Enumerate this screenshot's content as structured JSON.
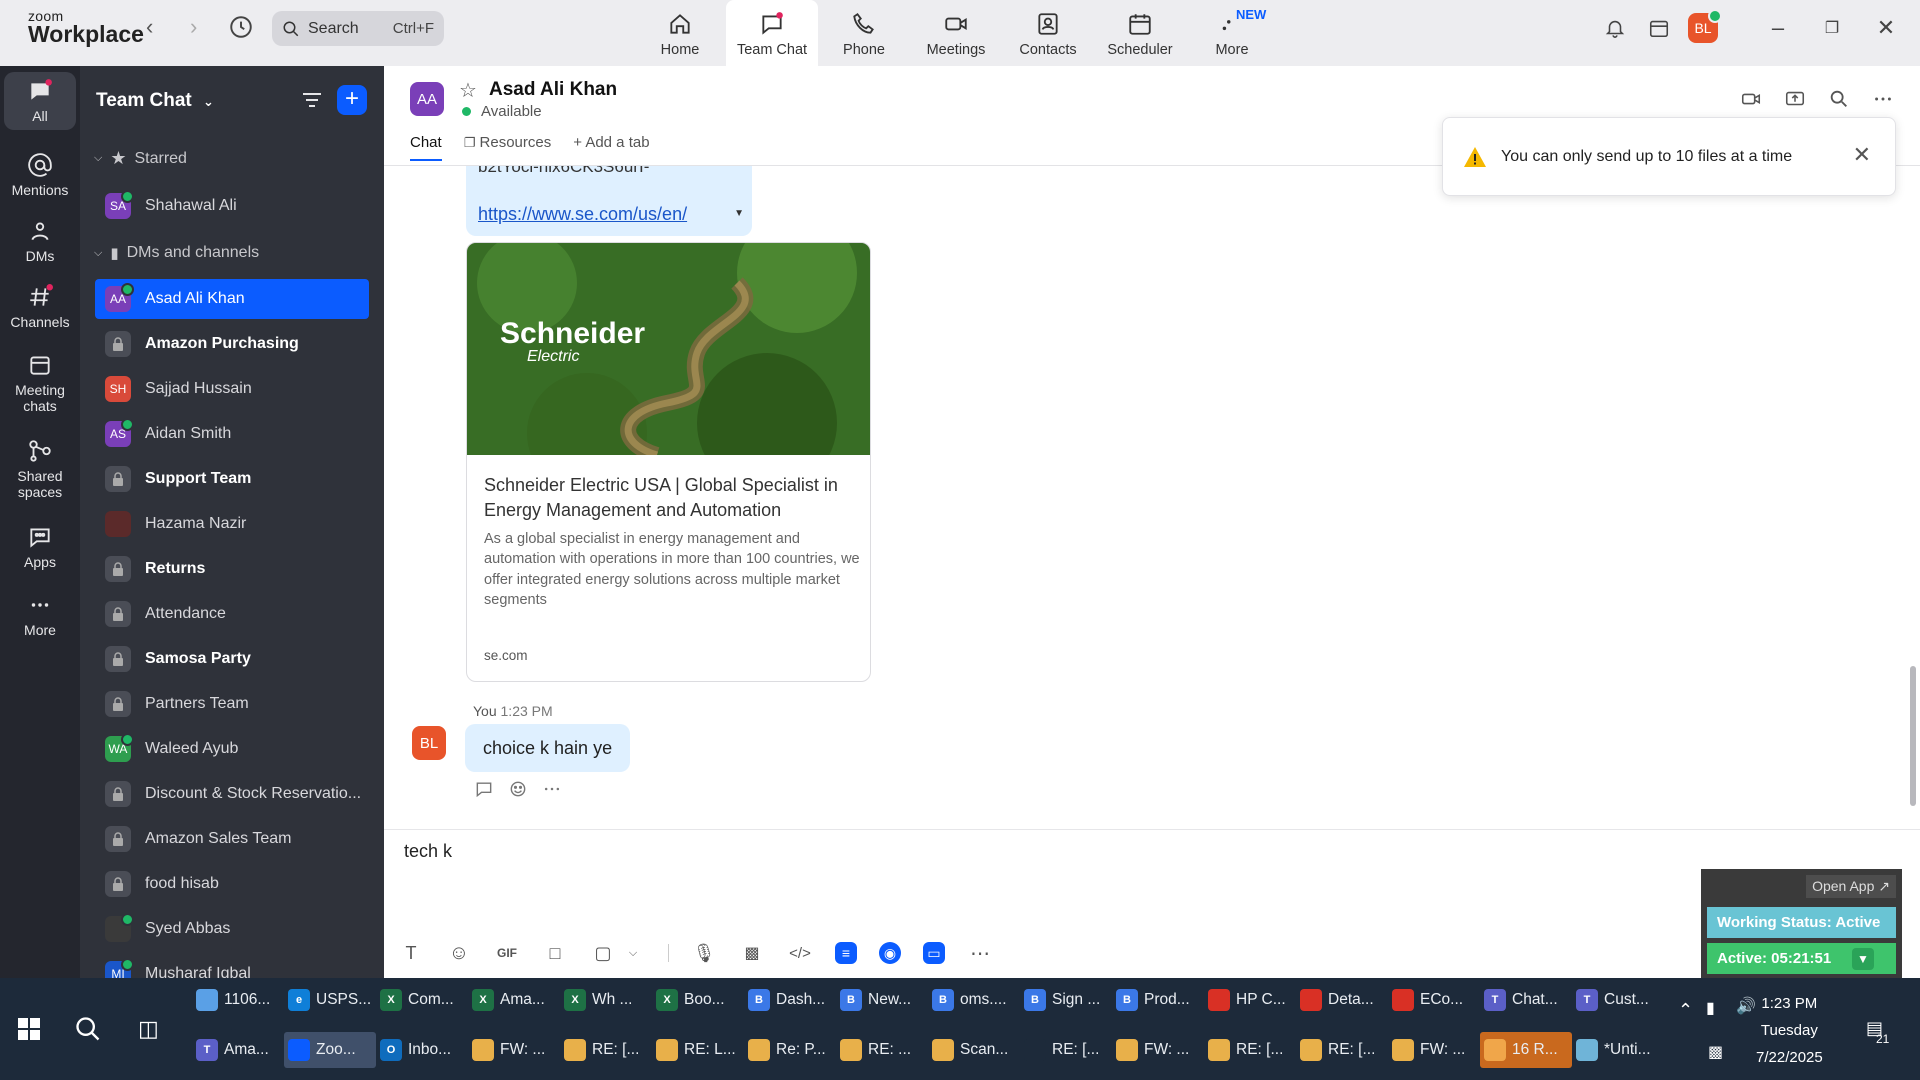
{
  "app": {
    "brand_small": "zoom",
    "brand_big": "Workplace"
  },
  "search": {
    "label": "Search",
    "shortcut": "Ctrl+F"
  },
  "top_tabs": [
    {
      "label": "Home"
    },
    {
      "label": "Team Chat"
    },
    {
      "label": "Phone"
    },
    {
      "label": "Meetings"
    },
    {
      "label": "Contacts"
    },
    {
      "label": "Scheduler"
    },
    {
      "label": "More",
      "badge": "NEW"
    }
  ],
  "user_initials": "BL",
  "rail": [
    {
      "label": "All"
    },
    {
      "label": "Mentions"
    },
    {
      "label": "DMs"
    },
    {
      "label": "Channels"
    },
    {
      "label": "Meeting chats"
    },
    {
      "label": "Shared spaces"
    },
    {
      "label": "Apps"
    },
    {
      "label": "More"
    }
  ],
  "sidebar": {
    "title": "Team Chat",
    "starred_label": "Starred",
    "dms_label": "DMs and channels",
    "starred": [
      {
        "initials": "SA",
        "name": "Shahawal Ali",
        "color": "#7a3fb8"
      }
    ],
    "items": [
      {
        "initials": "AA",
        "name": "Asad Ali Khan",
        "color": "#7a3fb8"
      },
      {
        "name": "Amazon Purchasing"
      },
      {
        "initials": "SH",
        "name": "Sajjad Hussain",
        "color": "#d94a3a"
      },
      {
        "initials": "AS",
        "name": "Aidan Smith",
        "color": "#7a3fb8"
      },
      {
        "name": "Support Team"
      },
      {
        "initials": "",
        "name": "Hazama Nazir",
        "color": "#5b2a2a"
      },
      {
        "name": "Returns"
      },
      {
        "name": "Attendance"
      },
      {
        "name": "Samosa Party"
      },
      {
        "name": "Partners Team"
      },
      {
        "initials": "WA",
        "name": "Waleed Ayub",
        "color": "#2e9e4f"
      },
      {
        "name": "Discount & Stock Reservatio..."
      },
      {
        "name": "Amazon Sales Team"
      },
      {
        "name": "food hisab"
      },
      {
        "initials": "",
        "name": "Syed Abbas",
        "color": "#3a3a3a"
      },
      {
        "initials": "MI",
        "name": "Musharaf Iqbal",
        "color": "#1a56c9"
      }
    ]
  },
  "chat": {
    "contact_initials": "AA",
    "contact_name": "Asad Ali Khan",
    "status": "Available",
    "tabs": {
      "chat": "Chat",
      "resources": "Resources",
      "add": "Add a tab"
    },
    "link_fragment": "b2tYoci-nix6CK3S6urI-",
    "link_url": "https://www.se.com/us/en/",
    "card": {
      "logo_main": "Schneider",
      "logo_sub": "Electric",
      "title": "Schneider Electric USA | Global Specialist in Energy Management and Automation",
      "description": "As a global specialist in energy management  and automation with operations in more than 100 countries, we offer integrated energy solutions across multiple market segments",
      "domain": "se.com"
    },
    "message": {
      "sender": "You",
      "time": "1:23 PM",
      "initials": "BL",
      "text": "choice k hain ye"
    },
    "compose_text": "tech k"
  },
  "toast": {
    "text": "You can only send up to 10 files at a time"
  },
  "widget": {
    "open_app": "Open App ↗",
    "working_status": "Working Status: Active",
    "active_time": "Active: 05:21:51"
  },
  "taskbar": {
    "row1": [
      {
        "label": "1106...",
        "color": "#5aa0e6",
        "glyph": ""
      },
      {
        "label": "USPS...",
        "color": "#0f7fd8",
        "glyph": "e"
      },
      {
        "label": "Com...",
        "color": "#1e7145",
        "glyph": "X"
      },
      {
        "label": "Ama...",
        "color": "#1e7145",
        "glyph": "X"
      },
      {
        "label": "Wh ...",
        "color": "#1e7145",
        "glyph": "X"
      },
      {
        "label": "Boo...",
        "color": "#1e7145",
        "glyph": "X"
      },
      {
        "label": "Dash...",
        "color": "#3b78e7",
        "glyph": "B"
      },
      {
        "label": "New...",
        "color": "#3b78e7",
        "glyph": "B"
      },
      {
        "label": "oms....",
        "color": "#3b78e7",
        "glyph": "B"
      },
      {
        "label": "Sign ...",
        "color": "#3b78e7",
        "glyph": "B"
      },
      {
        "label": "Prod...",
        "color": "#3b78e7",
        "glyph": "B"
      },
      {
        "label": "HP C...",
        "color": "#d93025",
        "glyph": ""
      },
      {
        "label": "Deta...",
        "color": "#d93025",
        "glyph": ""
      },
      {
        "label": "ECo...",
        "color": "#d93025",
        "glyph": ""
      },
      {
        "label": "Chat...",
        "color": "#5b5fc7",
        "glyph": "T"
      },
      {
        "label": "Cust...",
        "color": "#5b5fc7",
        "glyph": "T"
      }
    ],
    "row2": [
      {
        "label": "Ama...",
        "color": "#5b5fc7",
        "glyph": "T"
      },
      {
        "label": "Zoo...",
        "color": "#0b5cff",
        "glyph": "zoom"
      },
      {
        "label": "Inbo...",
        "color": "#0f6cbd",
        "glyph": "O"
      },
      {
        "label": "FW: ...",
        "color": "#e8b04a",
        "glyph": ""
      },
      {
        "label": "RE: [...",
        "color": "#e8b04a",
        "glyph": ""
      },
      {
        "label": "RE: L...",
        "color": "#e8b04a",
        "glyph": ""
      },
      {
        "label": "Re: P...",
        "color": "#e8b04a",
        "glyph": ""
      },
      {
        "label": "RE: ...",
        "color": "#e8b04a",
        "glyph": ""
      },
      {
        "label": "Scan...",
        "color": "#e8b04a",
        "glyph": ""
      },
      {
        "label": "RE: [...",
        "color": "#1d2a3a",
        "glyph": ""
      },
      {
        "label": "FW: ...",
        "color": "#e8b04a",
        "glyph": ""
      },
      {
        "label": "RE: [...",
        "color": "#e8b04a",
        "glyph": ""
      },
      {
        "label": "RE: [...",
        "color": "#e8b04a",
        "glyph": ""
      },
      {
        "label": "FW: ...",
        "color": "#e8b04a",
        "glyph": ""
      },
      {
        "label": "16 R...",
        "color": "#f0a64a",
        "glyph": ""
      },
      {
        "label": "*Unti...",
        "color": "#6fb4d8",
        "glyph": ""
      }
    ],
    "time": "1:23 PM",
    "day": "Tuesday",
    "date": "7/22/2025",
    "notif_count": "21"
  }
}
